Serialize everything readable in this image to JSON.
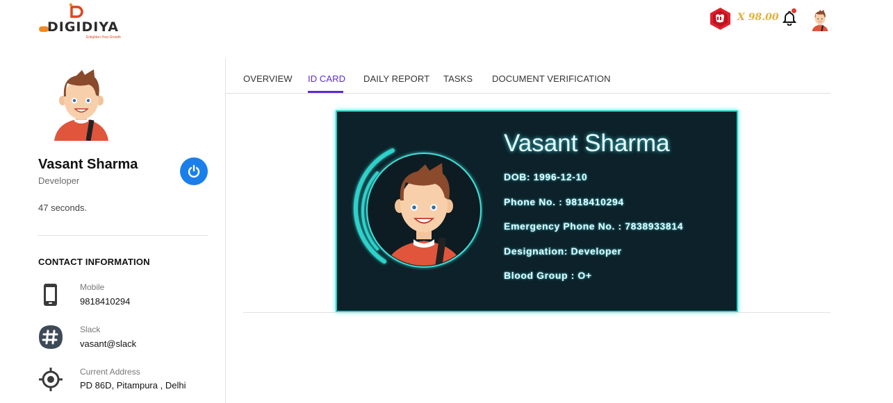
{
  "header": {
    "logo_text": "DIGIDIYA",
    "logo_tagline": "Enlighten Your Growth",
    "coin_amount": "X 98.00"
  },
  "profile": {
    "name": "Vasant Sharma",
    "role": "Developer",
    "elapsed": "47 seconds."
  },
  "contact": {
    "title": "CONTACT INFORMATION",
    "items": [
      {
        "label": "Mobile",
        "value": "9818410294",
        "icon": "phone-icon"
      },
      {
        "label": "Slack",
        "value": "vasant@slack",
        "icon": "slack-icon"
      },
      {
        "label": "Current Address",
        "value": "PD 86D, Pitampura , Delhi",
        "icon": "location-icon"
      }
    ]
  },
  "tabs": [
    {
      "label": "OVERVIEW"
    },
    {
      "label": "ID CARD",
      "active": true
    },
    {
      "label": "DAILY REPORT"
    },
    {
      "label": "TASKS"
    },
    {
      "label": "DOCUMENT VERIFICATION"
    }
  ],
  "id_card": {
    "name": "Vasant Sharma",
    "dob": "DOB: 1996-12-10",
    "phone": "Phone No. : 9818410294",
    "emergency": "Emergency Phone No. : 7838933814",
    "designation": "Designation: Developer",
    "blood_group": "Blood Group : O+"
  },
  "colors": {
    "accent": "#5b2bd6",
    "power_button": "#1a7fea",
    "card_bg": "#0c2129",
    "card_glow": "#29cfc7",
    "coin": "#e3b23a",
    "notification_dot": "#e53935"
  }
}
